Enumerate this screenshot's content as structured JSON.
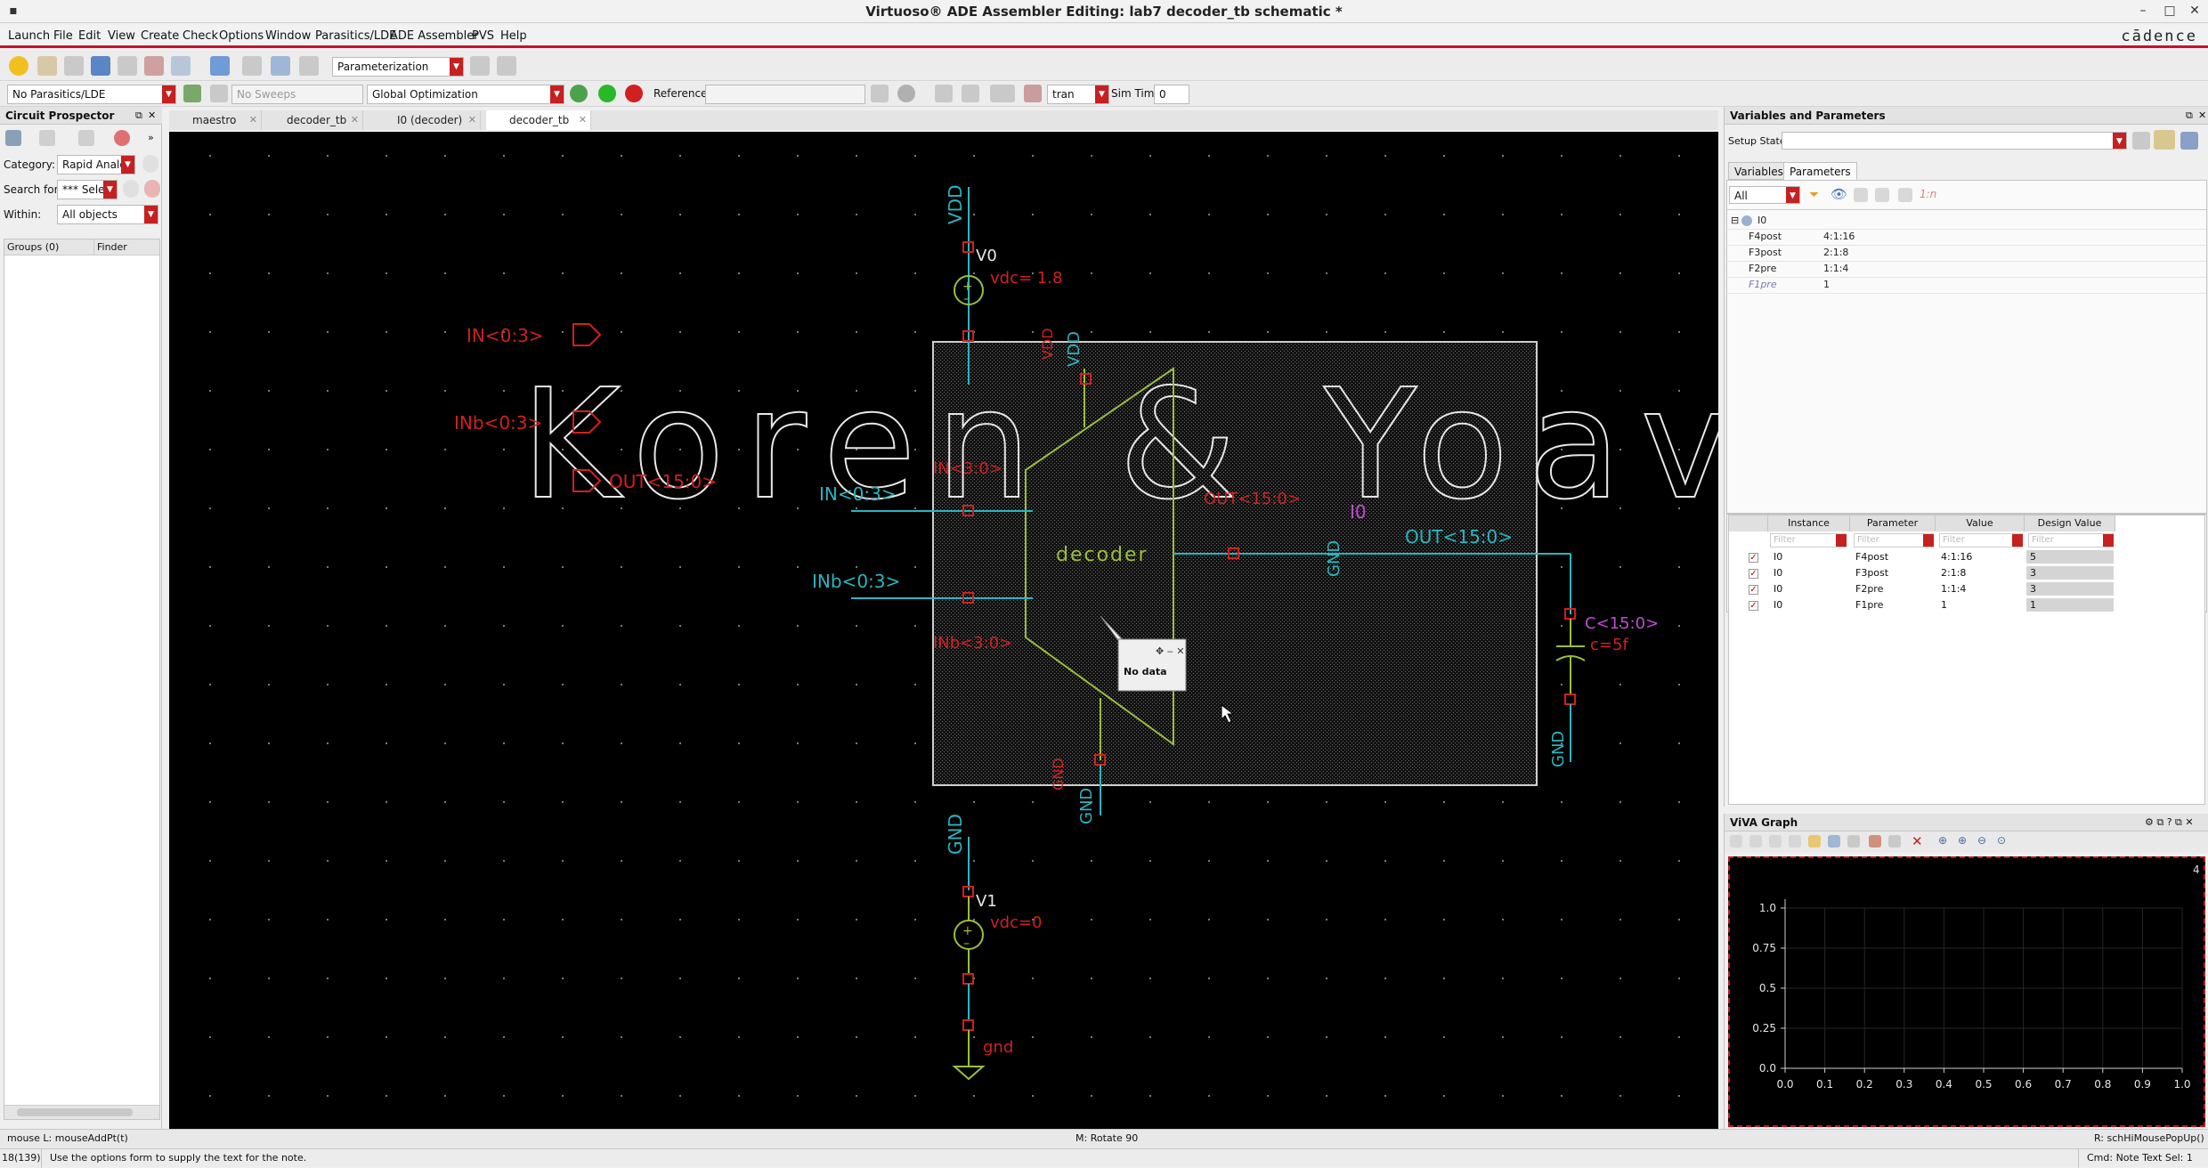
{
  "window": {
    "title": "Virtuoso® ADE Assembler Editing: lab7 decoder_tb schematic *",
    "brand": "cādence"
  },
  "menu": [
    "Launch",
    "File",
    "Edit",
    "View",
    "Create",
    "Check",
    "Options",
    "Window",
    "Parasitics/LDE",
    "ADE Assembler",
    "PVS",
    "Help"
  ],
  "toolbar1": {
    "mode": "Parameterization"
  },
  "toolbar2": {
    "parasitics": "No Parasitics/LDE",
    "sweeps": "No Sweeps",
    "optimization": "Global Optimization",
    "reference_label": "Reference:",
    "analysis": "tran",
    "simtime_label": "Sim Time",
    "simtime_value": "0"
  },
  "tabs": [
    {
      "label": "maestro",
      "active": false
    },
    {
      "label": "decoder_tb",
      "active": false
    },
    {
      "label": "I0 (decoder)",
      "active": false
    },
    {
      "label": "decoder_tb",
      "active": true
    }
  ],
  "circuit_prospector": {
    "title": "Circuit Prospector",
    "category_label": "Category:",
    "category_value": "Rapid Analog",
    "search_label": "Search for:",
    "search_value": "*** Selec",
    "within_label": "Within:",
    "within_value": "All objects",
    "col_groups": "Groups (0)",
    "col_finder": "Finder"
  },
  "schematic": {
    "watermark": "Koren & Yoav",
    "vdd_top": "VDD",
    "v0_name": "V0",
    "v0_value": "vdc= 1.8",
    "pin_in": "IN<0:3>",
    "pin_inb": "INb<0:3>",
    "pin_out": "OUT<15:0>",
    "net_in": "IN<0:3>",
    "net_inb": "INb<0:3>",
    "net_out": "OUT<15:0>",
    "block_name": "decoder",
    "block_inst": "I0",
    "blk_vdd": "VDD",
    "blk_gnd": "GND",
    "blk_in": "IN<3:0>",
    "blk_inb": "INb<3:0>",
    "blk_out": "OUT<15:0>",
    "gnd_mid": "GND",
    "gnd_right": "GND",
    "gnd_bottom": "GND",
    "gnd_net": "GND",
    "cap_name": "C<15:0>",
    "cap_value": "c=5f",
    "gnd_top_v1": "GND",
    "v1_name": "V1",
    "v1_value": "vdc=0",
    "gnd_sym": "gnd",
    "note_text": "No data"
  },
  "vars_params": {
    "title": "Variables and Parameters",
    "setup_state_label": "Setup State:",
    "tab_variables": "Variables",
    "tab_parameters": "Parameters",
    "filter_value": "All",
    "funnel_label": "1:n",
    "tree_root": "I0",
    "tree": [
      {
        "name": "F4post",
        "value": "4:1:16"
      },
      {
        "name": "F3post",
        "value": "2:1:8"
      },
      {
        "name": "F2pre",
        "value": "1:1:4"
      },
      {
        "name": "F1pre",
        "value": "1"
      }
    ],
    "table_headers": [
      "Instance",
      "Parameter",
      "Value",
      "Design Value"
    ],
    "filter_placeholder": "Filter",
    "rows": [
      {
        "instance": "I0",
        "parameter": "F4post",
        "value": "4:1:16",
        "design_value": "5"
      },
      {
        "instance": "I0",
        "parameter": "F3post",
        "value": "2:1:8",
        "design_value": "3"
      },
      {
        "instance": "I0",
        "parameter": "F2pre",
        "value": "1:1:4",
        "design_value": "3"
      },
      {
        "instance": "I0",
        "parameter": "F1pre",
        "value": "1",
        "design_value": "1"
      }
    ]
  },
  "viva": {
    "title": "ViVA Graph",
    "corner_num": "4",
    "y_ticks": [
      "1.0",
      "0.75",
      "0.5",
      "0.25",
      "0.0"
    ],
    "x_ticks": [
      "0.0",
      "0.1",
      "0.2",
      "0.3",
      "0.4",
      "0.5",
      "0.6",
      "0.7",
      "0.8",
      "0.9",
      "1.0"
    ]
  },
  "status": {
    "mouse_l": "mouse L: mouseAddPt(t)",
    "mouse_m": "M: Rotate 90",
    "mouse_r": "R: schHiMousePopUp()",
    "line_no": "18(139)",
    "prompt": "Use the options form to supply the text for the note.",
    "cmd": "Cmd: Note Text  Sel: 1"
  },
  "colors": {
    "wire": "#2bb5c0",
    "red": "#d12020",
    "symbol": "#9bbf3a",
    "magenta": "#c04bd3"
  }
}
